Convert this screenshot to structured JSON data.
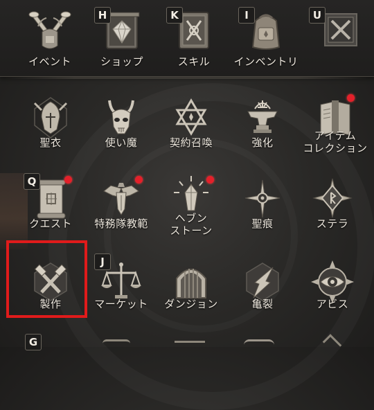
{
  "top_menu": [
    {
      "label": "イベント",
      "icon": "crossed-trumpets-icon",
      "hotkey": ""
    },
    {
      "label": "ショップ",
      "icon": "shop-chest-icon",
      "hotkey": "H"
    },
    {
      "label": "スキル",
      "icon": "skill-book-icon",
      "hotkey": "K"
    },
    {
      "label": "インベントリ",
      "icon": "backpack-icon",
      "hotkey": "I"
    },
    {
      "label": "",
      "icon": "x-emblem-icon",
      "hotkey": "U"
    }
  ],
  "grid_menu": [
    {
      "label": "聖衣",
      "icon": "knight-helm-icon",
      "hotkey": "",
      "notification": false
    },
    {
      "label": "使い魔",
      "icon": "horned-skull-icon",
      "hotkey": "",
      "notification": false
    },
    {
      "label": "契約召喚",
      "icon": "hexagram-icon",
      "hotkey": "",
      "notification": false
    },
    {
      "label": "強化",
      "icon": "anvil-icon",
      "hotkey": "",
      "notification": false
    },
    {
      "label_lines": [
        "アイテム",
        "コレクション"
      ],
      "icon": "item-book-icon",
      "hotkey": "",
      "notification": true
    },
    {
      "label": "クエスト",
      "icon": "quest-scroll-icon",
      "hotkey": "Q",
      "notification": true
    },
    {
      "label": "特務隊教範",
      "icon": "eagle-crest-icon",
      "hotkey": "",
      "notification": true
    },
    {
      "label_lines": [
        "ヘブン",
        "ストーン"
      ],
      "icon": "heaven-crystal-icon",
      "hotkey": "",
      "notification": true
    },
    {
      "label": "聖痕",
      "icon": "stigma-compass-icon",
      "hotkey": "",
      "notification": false
    },
    {
      "label": "ステラ",
      "icon": "stella-rune-icon",
      "hotkey": "",
      "notification": false
    },
    {
      "label": "製作",
      "icon": "crossed-hammers-icon",
      "hotkey": "",
      "notification": false
    },
    {
      "label": "マーケット",
      "icon": "scales-icon",
      "hotkey": "J",
      "notification": false
    },
    {
      "label": "ダンジョン",
      "icon": "dungeon-gate-icon",
      "hotkey": "",
      "notification": false
    },
    {
      "label": "亀裂",
      "icon": "rift-crystal-icon",
      "hotkey": "",
      "notification": false
    },
    {
      "label": "アビス",
      "icon": "abyss-eye-icon",
      "hotkey": "",
      "notification": false
    }
  ],
  "bottom_row_hotkey": "G",
  "colors": {
    "highlight": "#e01b1b",
    "notification": "#e4202a",
    "icon_metal": "#b8b2a6"
  }
}
